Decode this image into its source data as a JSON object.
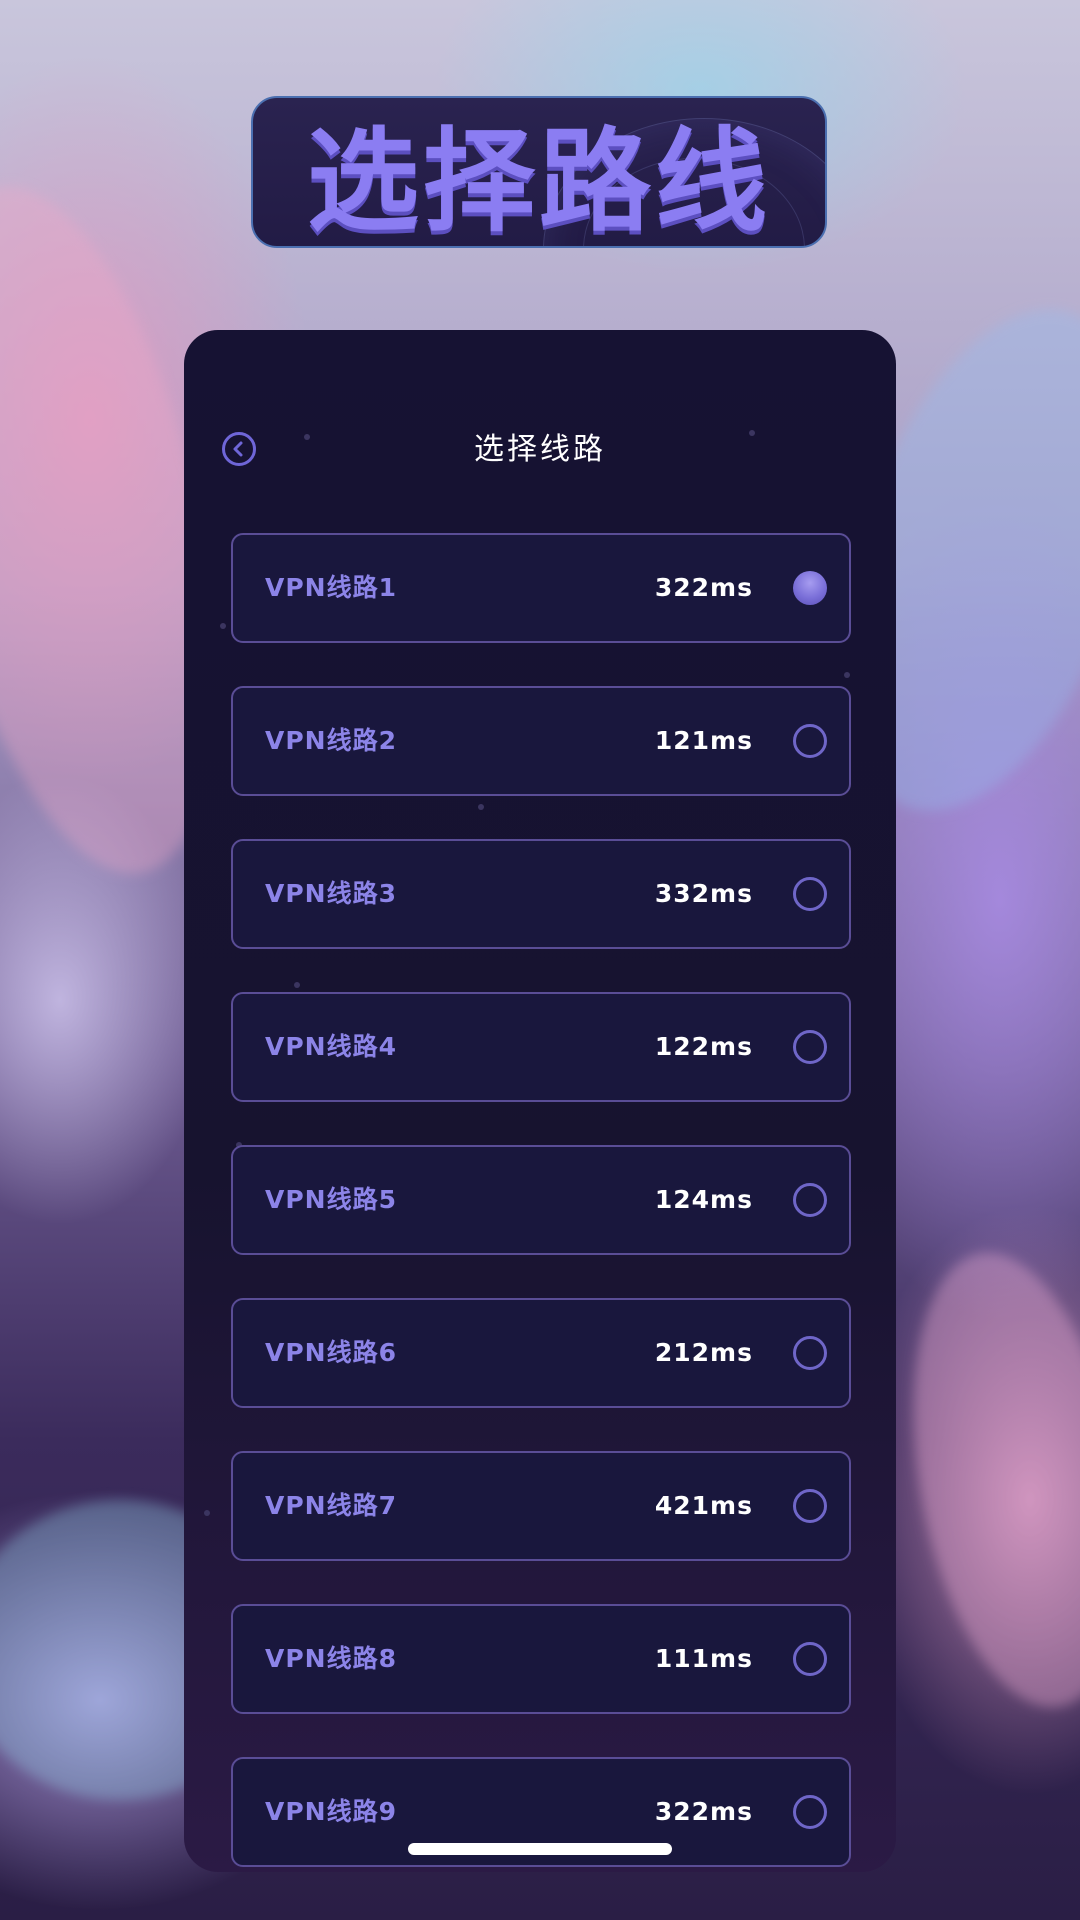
{
  "banner": {
    "title": "选择路线"
  },
  "panel": {
    "title": "选择线路",
    "back_icon": "chevron-left-circle-icon"
  },
  "routes": [
    {
      "name": "VPN线路1",
      "latency": "322ms",
      "selected": true
    },
    {
      "name": "VPN线路2",
      "latency": "121ms",
      "selected": false
    },
    {
      "name": "VPN线路3",
      "latency": "332ms",
      "selected": false
    },
    {
      "name": "VPN线路4",
      "latency": "122ms",
      "selected": false
    },
    {
      "name": "VPN线路5",
      "latency": "124ms",
      "selected": false
    },
    {
      "name": "VPN线路6",
      "latency": "212ms",
      "selected": false
    },
    {
      "name": "VPN线路7",
      "latency": "421ms",
      "selected": false
    },
    {
      "name": "VPN线路8",
      "latency": "111ms",
      "selected": false
    },
    {
      "name": "VPN线路9",
      "latency": "322ms",
      "selected": false
    }
  ],
  "colors": {
    "accent": "#8c84e8",
    "panel_bg": "#161233",
    "item_border": "#5a4d96"
  }
}
